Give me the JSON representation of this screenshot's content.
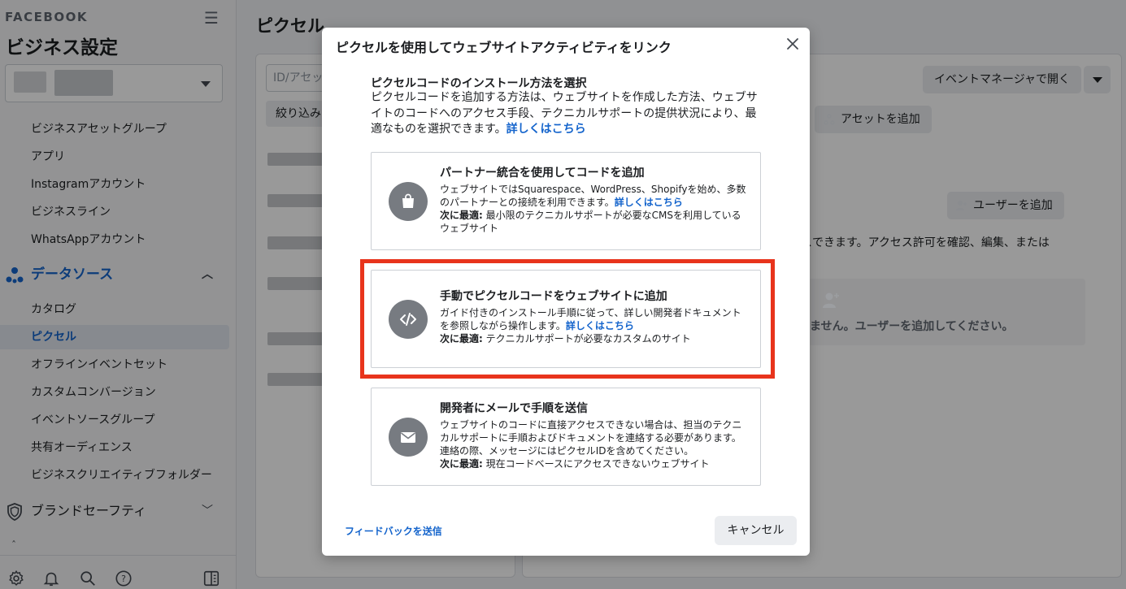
{
  "sidebar": {
    "brand": "FACEBOOK",
    "title": "ビジネス設定",
    "items_top": [
      "ビジネスアセットグループ",
      "アプリ",
      "Instagramアカウント",
      "ビジネスライン",
      "WhatsAppアカウント"
    ],
    "data_source_label": "データソース",
    "data_items": [
      "カタログ",
      "ピクセル",
      "オフラインイベントセット",
      "カスタムコンバージョン",
      "イベントソースグループ",
      "共有オーディエンス",
      "ビジネスクリエイティブフォルダー"
    ],
    "brand_safety_label": "ブランドセーフティ"
  },
  "main": {
    "title": "ピクセル",
    "search_placeholder": "ID/アセット",
    "filter_label": "絞り込み",
    "event_manager_button": "イベントマネージャで開く",
    "add_asset_button": "アセットを追加",
    "add_user_button": "ユーザーを追加",
    "access_text": "スできます。アクセス許可を確認、編集、または",
    "empty_text": "ません。ユーザーを追加してください。"
  },
  "modal": {
    "title": "ピクセルを使用してウェブサイトアクティビティをリンク",
    "intro_heading": "ピクセルコードのインストール方法を選択",
    "intro_body": "ピクセルコードを追加する方法は、ウェブサイトを作成した方法、ウェブサイトのコードへのアクセス手段、テクニカルサポートの提供状況により、最適なものを選択できます。",
    "learn_more": "詳しくはこちら",
    "best_label": "次に最適:",
    "options": [
      {
        "title": "パートナー統合を使用してコードを追加",
        "desc": "ウェブサイトではSquarespace、WordPress、Shopifyを始め、多数のパートナーとの接続を利用できます。",
        "best": "最小限のテクニカルサポートが必要なCMSを利用しているウェブサイト"
      },
      {
        "title": "手動でピクセルコードをウェブサイトに追加",
        "desc": "ガイド付きのインストール手順に従って、詳しい開発者ドキュメントを参照しながら操作します。",
        "best": "テクニカルサポートが必要なカスタムのサイト"
      },
      {
        "title": "開発者にメールで手順を送信",
        "desc": "ウェブサイトのコードに直接アクセスできない場合は、担当のテクニカルサポートに手順およびドキュメントを連絡する必要があります。連絡の際、メッセージにはピクセルIDを含めてください。",
        "best": "現在コードベースにアクセスできないウェブサイト"
      }
    ],
    "feedback_link": "フィードバックを送信",
    "cancel_button": "キャンセル"
  }
}
